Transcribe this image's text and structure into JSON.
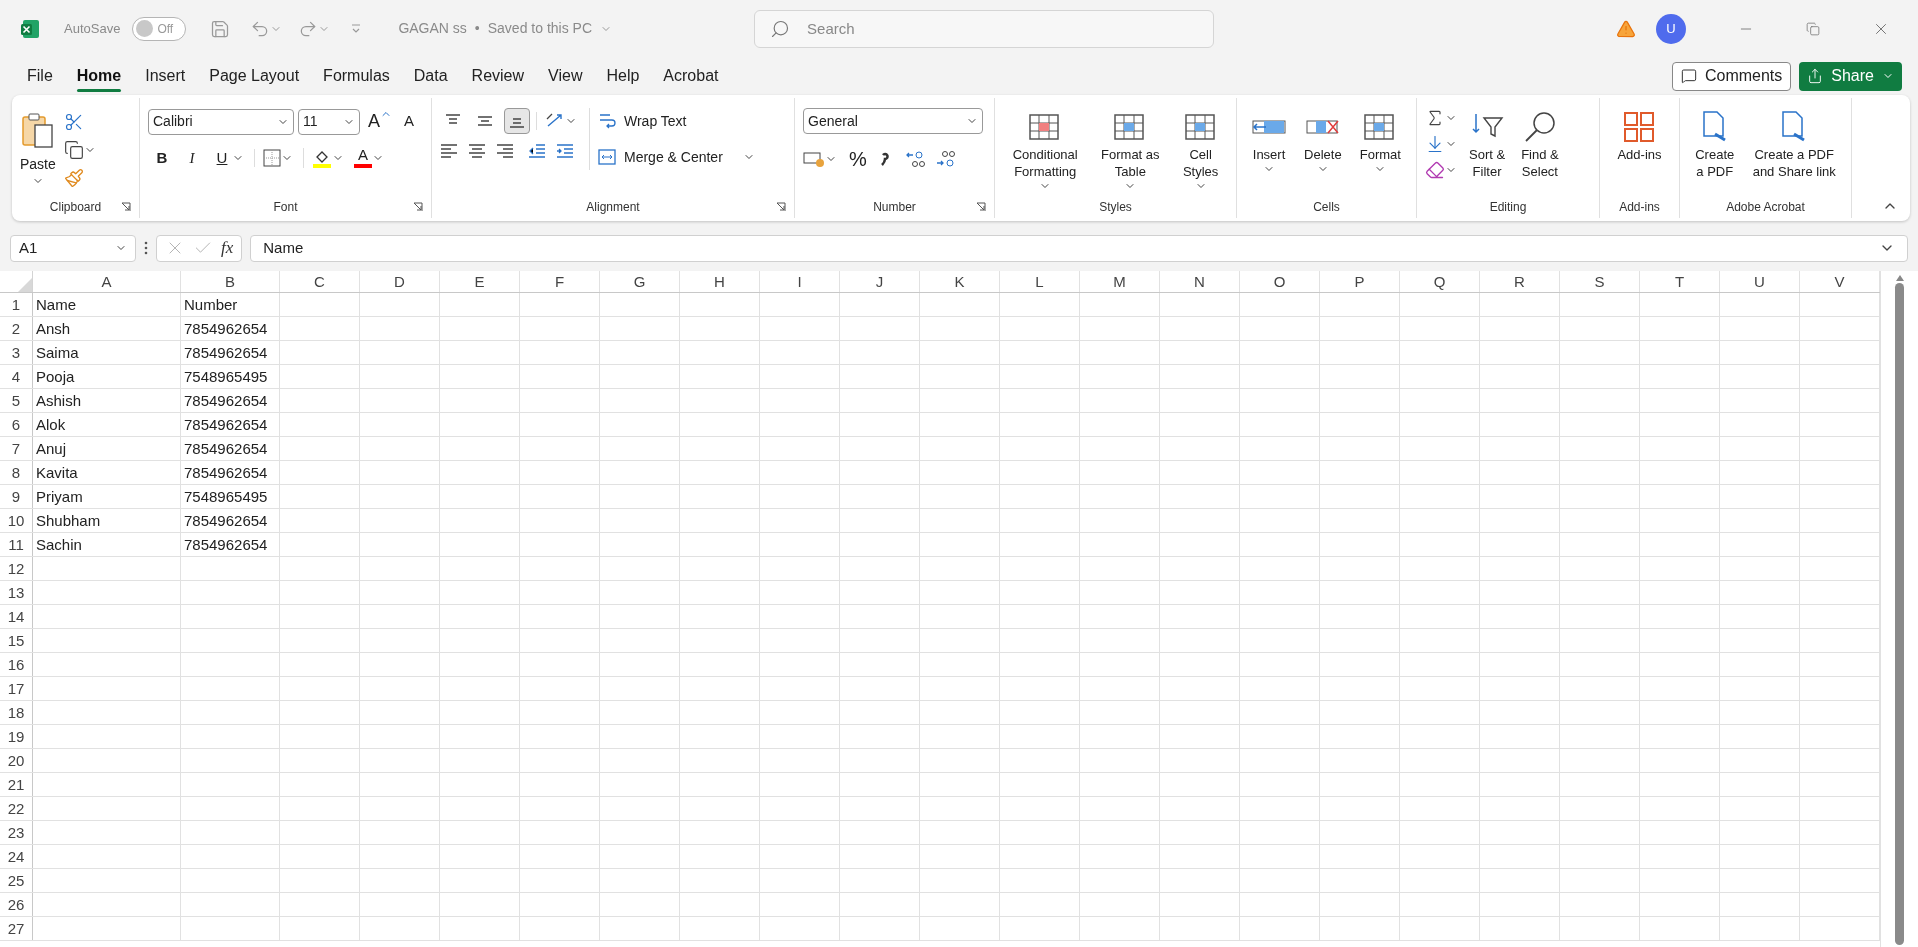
{
  "title_bar": {
    "autosave_label": "AutoSave",
    "autosave_on": false,
    "autosave_state": "Off",
    "file_title": "GAGAN ss",
    "separator": "•",
    "save_status": "Saved to this PC",
    "search_placeholder": "Search",
    "avatar": "U"
  },
  "menu_tabs": [
    {
      "label": "File",
      "selected": false
    },
    {
      "label": "Home",
      "selected": true
    },
    {
      "label": "Insert",
      "selected": false
    },
    {
      "label": "Page Layout",
      "selected": false
    },
    {
      "label": "Formulas",
      "selected": false
    },
    {
      "label": "Data",
      "selected": false
    },
    {
      "label": "Review",
      "selected": false
    },
    {
      "label": "View",
      "selected": false
    },
    {
      "label": "Help",
      "selected": false
    },
    {
      "label": "Acrobat",
      "selected": false
    }
  ],
  "comments_button": "Comments",
  "share_button": "Share",
  "ribbon": {
    "clipboard": {
      "label": "Clipboard",
      "paste": "Paste"
    },
    "font": {
      "label": "Font",
      "font_name": "Calibri",
      "font_size": "11",
      "grow": "A",
      "shrink": "A",
      "bold": "B",
      "italic": "I",
      "underline": "U",
      "font_color": "A"
    },
    "alignment": {
      "label": "Alignment",
      "wrap_text": "Wrap Text",
      "merge_center": "Merge & Center",
      "bottom_align_selected": true
    },
    "number": {
      "label": "Number",
      "format": "General",
      "percent": "%"
    },
    "styles": {
      "label": "Styles",
      "conditional": "Conditional\nFormatting",
      "format_table": "Format as\nTable",
      "cell_styles": "Cell\nStyles"
    },
    "cells": {
      "label": "Cells",
      "insert": "Insert",
      "delete": "Delete",
      "format": "Format"
    },
    "editing": {
      "label": "Editing",
      "sort": "Sort &\nFilter",
      "find": "Find &\nSelect"
    },
    "addins": {
      "label": "Add-ins",
      "addins": "Add-ins"
    },
    "acrobat": {
      "label": "Adobe Acrobat",
      "create_pdf": "Create\na PDF",
      "create_share": "Create a PDF\nand Share link"
    }
  },
  "formula_bar": {
    "name_box": "A1",
    "fx": "fx",
    "formula": "Name"
  },
  "sheet": {
    "columns": [
      "A",
      "B",
      "C",
      "D",
      "E",
      "F",
      "G",
      "H",
      "I",
      "J",
      "K",
      "L",
      "M",
      "N",
      "O",
      "P",
      "Q",
      "R",
      "S",
      "T",
      "U",
      "V"
    ],
    "rows": [
      {
        "number": "1",
        "cells": [
          "Name",
          "Number"
        ]
      },
      {
        "number": "2",
        "cells": [
          "Ansh",
          "7854962654"
        ]
      },
      {
        "number": "3",
        "cells": [
          "Saima",
          "7854962654"
        ]
      },
      {
        "number": "4",
        "cells": [
          "Pooja",
          "7548965495"
        ]
      },
      {
        "number": "5",
        "cells": [
          "Ashish",
          "7854962654"
        ]
      },
      {
        "number": "6",
        "cells": [
          "Alok",
          "7854962654"
        ]
      },
      {
        "number": "7",
        "cells": [
          "Anuj",
          "7854962654"
        ]
      },
      {
        "number": "8",
        "cells": [
          "Kavita",
          "7854962654"
        ]
      },
      {
        "number": "9",
        "cells": [
          "Priyam",
          "7548965495"
        ]
      },
      {
        "number": "10",
        "cells": [
          "Shubham",
          "7854962654"
        ]
      },
      {
        "number": "11",
        "cells": [
          "Sachin",
          "7854962654"
        ]
      },
      {
        "number": "12"
      },
      {
        "number": "13"
      },
      {
        "number": "14"
      },
      {
        "number": "15"
      },
      {
        "number": "16"
      },
      {
        "number": "17"
      },
      {
        "number": "18"
      },
      {
        "number": "19"
      },
      {
        "number": "20"
      },
      {
        "number": "21"
      },
      {
        "number": "22"
      },
      {
        "number": "23"
      },
      {
        "number": "24"
      },
      {
        "number": "25"
      },
      {
        "number": "26"
      },
      {
        "number": "27"
      }
    ]
  }
}
